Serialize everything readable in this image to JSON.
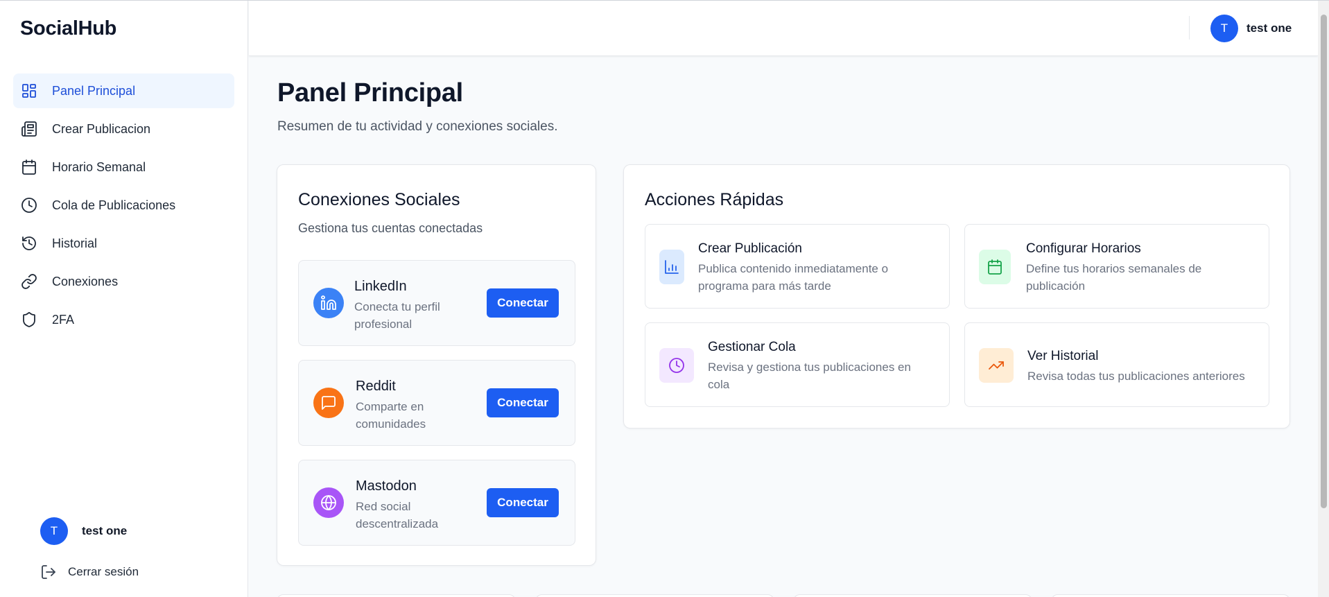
{
  "app": {
    "brand": "SocialHub"
  },
  "sidebar": {
    "items": [
      {
        "label": "Panel Principal",
        "icon": "dashboard-icon",
        "active": true
      },
      {
        "label": "Crear Publicacion",
        "icon": "newspaper-icon"
      },
      {
        "label": "Horario Semanal",
        "icon": "calendar-icon"
      },
      {
        "label": "Cola de Publicaciones",
        "icon": "clock-icon"
      },
      {
        "label": "Historial",
        "icon": "history-icon"
      },
      {
        "label": "Conexiones",
        "icon": "link-icon"
      },
      {
        "label": "2FA",
        "icon": "shield-icon"
      }
    ],
    "user": {
      "initial": "T",
      "name": "test one"
    },
    "logout_label": "Cerrar sesión"
  },
  "topbar": {
    "user": {
      "initial": "T",
      "name": "test one"
    }
  },
  "main": {
    "title": "Panel Principal",
    "subtitle": "Resumen de tu actividad y conexiones sociales."
  },
  "social": {
    "title": "Conexiones Sociales",
    "subtitle": "Gestiona tus cuentas conectadas",
    "connections": [
      {
        "name": "LinkedIn",
        "description": "Conecta tu perfil profesional",
        "button": "Conectar",
        "color": "#3b82f6",
        "icon": "linkedin-icon"
      },
      {
        "name": "Reddit",
        "description": "Comparte en comunidades",
        "button": "Conectar",
        "color": "#f97316",
        "icon": "message-square-icon"
      },
      {
        "name": "Mastodon",
        "description": "Red social descentralizada",
        "button": "Conectar",
        "color": "#a855f7",
        "icon": "globe-icon"
      }
    ]
  },
  "quick_actions": {
    "title": "Acciones Rápidas",
    "items": [
      {
        "title": "Crear Publicación",
        "description": "Publica contenido inmediatamente o programa para más tarde",
        "icon": "bar-chart-icon",
        "bg": "#dbeafe",
        "fg": "#2563eb"
      },
      {
        "title": "Configurar Horarios",
        "description": "Define tus horarios semanales de publicación",
        "icon": "calendar-icon",
        "bg": "#dcfce7",
        "fg": "#16a34a"
      },
      {
        "title": "Gestionar Cola",
        "description": "Revisa y gestiona tus publicaciones en cola",
        "icon": "clock-icon",
        "bg": "#f3e8ff",
        "fg": "#9333ea"
      },
      {
        "title": "Ver Historial",
        "description": "Revisa todas tus publicaciones anteriores",
        "icon": "trending-up-icon",
        "bg": "#ffedd5",
        "fg": "#ea580c"
      }
    ]
  }
}
